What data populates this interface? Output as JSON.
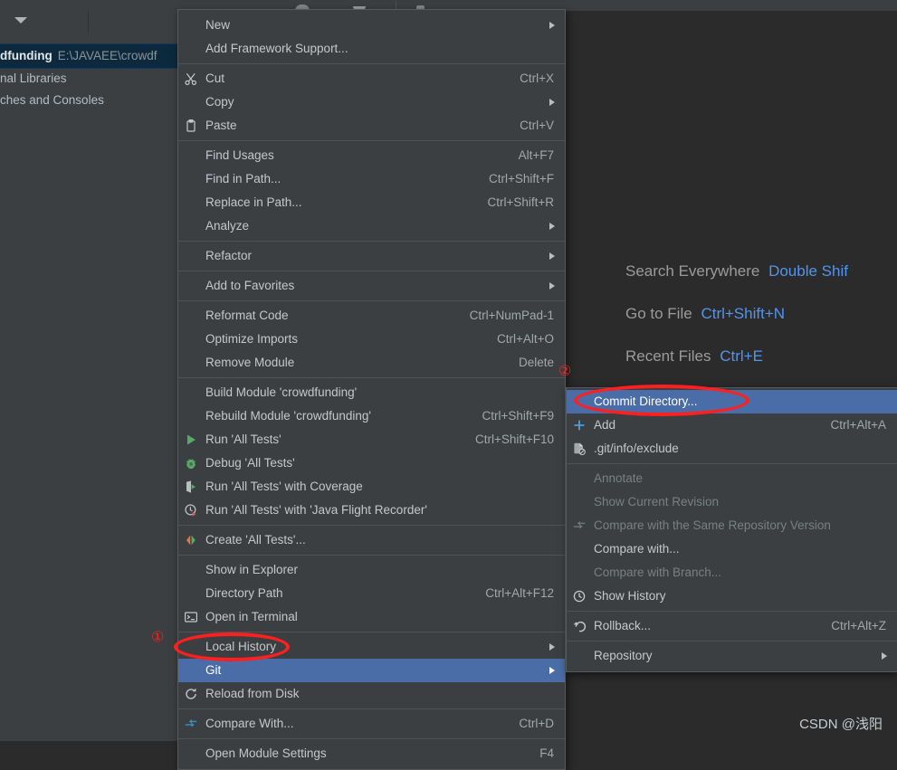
{
  "app": {
    "theme_background": "#2b2b2b",
    "menu_background": "#3c3f41",
    "selection_color": "#4a6da7",
    "annotation_color": "#ff1f1f",
    "shortcut_key_color": "#5394ec"
  },
  "project_tree": {
    "module_name": "dfunding",
    "module_path": "E:\\JAVAEE\\crowdf",
    "external_libraries": "nal Libraries",
    "scratches_and_consoles": "ches and Consoles"
  },
  "editor_hints": [
    {
      "label": "Search Everywhere",
      "key": "Double Shif"
    },
    {
      "label": "Go to File",
      "key": "Ctrl+Shift+N"
    },
    {
      "label": "Recent Files",
      "key": "Ctrl+E"
    }
  ],
  "watermark": "CSDN @浅阳 ",
  "annotations": {
    "marker_one": "①",
    "marker_two": "②"
  },
  "context_menu": {
    "items": [
      {
        "label": "New",
        "shortcut": "",
        "icon": "",
        "submenu": true,
        "selected": false,
        "disabled": false
      },
      {
        "label": "Add Framework Support...",
        "shortcut": "",
        "icon": "",
        "submenu": false,
        "selected": false,
        "disabled": false
      },
      {
        "separator": true
      },
      {
        "label": "Cut",
        "shortcut": "Ctrl+X",
        "icon": "scissors-icon",
        "submenu": false,
        "selected": false,
        "disabled": false
      },
      {
        "label": "Copy",
        "shortcut": "",
        "icon": "",
        "submenu": true,
        "selected": false,
        "disabled": false
      },
      {
        "label": "Paste",
        "shortcut": "Ctrl+V",
        "icon": "clipboard-icon",
        "submenu": false,
        "selected": false,
        "disabled": false
      },
      {
        "separator": true
      },
      {
        "label": "Find Usages",
        "shortcut": "Alt+F7",
        "icon": "",
        "submenu": false,
        "selected": false,
        "disabled": false
      },
      {
        "label": "Find in Path...",
        "shortcut": "Ctrl+Shift+F",
        "icon": "",
        "submenu": false,
        "selected": false,
        "disabled": false
      },
      {
        "label": "Replace in Path...",
        "shortcut": "Ctrl+Shift+R",
        "icon": "",
        "submenu": false,
        "selected": false,
        "disabled": false
      },
      {
        "label": "Analyze",
        "shortcut": "",
        "icon": "",
        "submenu": true,
        "selected": false,
        "disabled": false
      },
      {
        "separator": true
      },
      {
        "label": "Refactor",
        "shortcut": "",
        "icon": "",
        "submenu": true,
        "selected": false,
        "disabled": false
      },
      {
        "separator": true
      },
      {
        "label": "Add to Favorites",
        "shortcut": "",
        "icon": "",
        "submenu": true,
        "selected": false,
        "disabled": false
      },
      {
        "separator": true
      },
      {
        "label": "Reformat Code",
        "shortcut": "Ctrl+NumPad-1",
        "icon": "",
        "submenu": false,
        "selected": false,
        "disabled": false
      },
      {
        "label": "Optimize Imports",
        "shortcut": "Ctrl+Alt+O",
        "icon": "",
        "submenu": false,
        "selected": false,
        "disabled": false
      },
      {
        "label": "Remove Module",
        "shortcut": "Delete",
        "icon": "",
        "submenu": false,
        "selected": false,
        "disabled": false
      },
      {
        "separator": true
      },
      {
        "label": "Build Module 'crowdfunding'",
        "shortcut": "",
        "icon": "",
        "submenu": false,
        "selected": false,
        "disabled": false
      },
      {
        "label": "Rebuild Module 'crowdfunding'",
        "shortcut": "Ctrl+Shift+F9",
        "icon": "",
        "submenu": false,
        "selected": false,
        "disabled": false
      },
      {
        "label": "Run 'All Tests'",
        "shortcut": "Ctrl+Shift+F10",
        "icon": "run-icon",
        "submenu": false,
        "selected": false,
        "disabled": false
      },
      {
        "label": "Debug 'All Tests'",
        "shortcut": "",
        "icon": "debug-icon",
        "submenu": false,
        "selected": false,
        "disabled": false
      },
      {
        "label": "Run 'All Tests' with Coverage",
        "shortcut": "",
        "icon": "coverage-icon",
        "submenu": false,
        "selected": false,
        "disabled": false
      },
      {
        "label": "Run 'All Tests' with 'Java Flight Recorder'",
        "shortcut": "",
        "icon": "flight-recorder-icon",
        "submenu": false,
        "selected": false,
        "disabled": false
      },
      {
        "separator": true
      },
      {
        "label": "Create 'All Tests'...",
        "shortcut": "",
        "icon": "create-config-icon",
        "submenu": false,
        "selected": false,
        "disabled": false
      },
      {
        "separator": true
      },
      {
        "label": "Show in Explorer",
        "shortcut": "",
        "icon": "",
        "submenu": false,
        "selected": false,
        "disabled": false
      },
      {
        "label": "Directory Path",
        "shortcut": "Ctrl+Alt+F12",
        "icon": "",
        "submenu": false,
        "selected": false,
        "disabled": false
      },
      {
        "label": "Open in Terminal",
        "shortcut": "",
        "icon": "terminal-icon",
        "submenu": false,
        "selected": false,
        "disabled": false
      },
      {
        "separator": true
      },
      {
        "label": "Local History",
        "shortcut": "",
        "icon": "",
        "submenu": true,
        "selected": false,
        "disabled": false
      },
      {
        "label": "Git",
        "shortcut": "",
        "icon": "",
        "submenu": true,
        "selected": true,
        "disabled": false
      },
      {
        "label": "Reload from Disk",
        "shortcut": "",
        "icon": "reload-icon",
        "submenu": false,
        "selected": false,
        "disabled": false
      },
      {
        "separator": true
      },
      {
        "label": "Compare With...",
        "shortcut": "Ctrl+D",
        "icon": "compare-icon",
        "submenu": false,
        "selected": false,
        "disabled": false
      },
      {
        "separator": true
      },
      {
        "label": "Open Module Settings",
        "shortcut": "F4",
        "icon": "",
        "submenu": false,
        "selected": false,
        "disabled": false
      }
    ]
  },
  "git_submenu": {
    "items": [
      {
        "label": "Commit Directory...",
        "shortcut": "",
        "icon": "",
        "submenu": false,
        "selected": true,
        "disabled": false
      },
      {
        "label": "Add",
        "shortcut": "Ctrl+Alt+A",
        "icon": "plus-icon",
        "submenu": false,
        "selected": false,
        "disabled": false
      },
      {
        "label": ".git/info/exclude",
        "shortcut": "",
        "icon": "file-exclude-icon",
        "submenu": false,
        "selected": false,
        "disabled": false
      },
      {
        "separator": true
      },
      {
        "label": "Annotate",
        "shortcut": "",
        "icon": "",
        "submenu": false,
        "selected": false,
        "disabled": true
      },
      {
        "label": "Show Current Revision",
        "shortcut": "",
        "icon": "",
        "submenu": false,
        "selected": false,
        "disabled": true
      },
      {
        "label": "Compare with the Same Repository Version",
        "shortcut": "",
        "icon": "compare-repo-icon",
        "submenu": false,
        "selected": false,
        "disabled": true
      },
      {
        "label": "Compare with...",
        "shortcut": "",
        "icon": "",
        "submenu": false,
        "selected": false,
        "disabled": false
      },
      {
        "label": "Compare with Branch...",
        "shortcut": "",
        "icon": "",
        "submenu": false,
        "selected": false,
        "disabled": true
      },
      {
        "label": "Show History",
        "shortcut": "",
        "icon": "history-icon",
        "submenu": false,
        "selected": false,
        "disabled": false
      },
      {
        "separator": true
      },
      {
        "label": "Rollback...",
        "shortcut": "Ctrl+Alt+Z",
        "icon": "rollback-icon",
        "submenu": false,
        "selected": false,
        "disabled": false
      },
      {
        "separator": true
      },
      {
        "label": "Repository",
        "shortcut": "",
        "icon": "",
        "submenu": true,
        "selected": false,
        "disabled": false
      }
    ]
  }
}
